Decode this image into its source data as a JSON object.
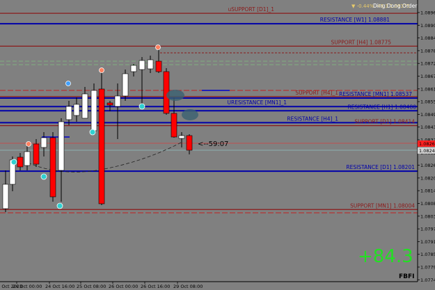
{
  "indicator_title": "Ding Dong Order",
  "top_info": "▼ -0.44%  -46.3  1.08375",
  "countdown": "<--59:07",
  "big_number": "+84.3",
  "watermark": "FBFI",
  "colors": {
    "background": "#808080",
    "support": "#8b1a1a",
    "resistance": "#0000aa",
    "bull_candle": "#ffffff",
    "bear_candle": "#ff0000",
    "big_number": "#22e022"
  },
  "levels": [
    {
      "label": "uSUPPORT [D1]_1",
      "price": 1.0893,
      "kind": "support"
    },
    {
      "label": "RESISTANCE [W1]  1.08881",
      "price": 1.08881,
      "kind": "resistance"
    },
    {
      "label": "SUPPORT [H4]  1.08775",
      "price": 1.08775,
      "kind": "support"
    },
    {
      "label": "SUPPORT [H4]_1",
      "price": 1.08537,
      "kind": "support"
    },
    {
      "label": "RESISTANCE [MN1]  1.08537",
      "price": 1.0853,
      "kind": "resistance"
    },
    {
      "label": "URESISTANCE [MN1]_1",
      "price": 1.0849,
      "kind": "resistance"
    },
    {
      "label": "RESISTANCE [H1]  1.08480",
      "price": 1.0847,
      "kind": "resistance"
    },
    {
      "label": "RESISTANCE [H4]_1",
      "price": 1.08414,
      "kind": "resistance"
    },
    {
      "label": "SUPPORT [D1]  1.08414",
      "price": 1.084,
      "kind": "support"
    },
    {
      "label": "RESISTANCE [D1]  1.08201",
      "price": 1.08185,
      "kind": "resistance"
    },
    {
      "label": "SUPPORT [MN1]  1.08004",
      "price": 1.08004,
      "kind": "support"
    }
  ],
  "price_axis": {
    "ticks": [
      "1.08960",
      "1.08900",
      "1.08845",
      "1.08785",
      "1.08725",
      "1.08670",
      "1.08610",
      "1.08550",
      "1.08495",
      "1.08435",
      "1.08375",
      "1.08320",
      "1.08260",
      "1.08200",
      "1.08145",
      "1.08085",
      "1.08030",
      "1.07970",
      "1.07910",
      "1.07855",
      "1.07795",
      "1.07740"
    ],
    "current_price": "1.08260",
    "bid_label": "1.08242",
    "top": 1.0896,
    "bottom": 1.0768
  },
  "time_axis": {
    "ticks": [
      "23 Oct 2023",
      "24 Oct 00:00",
      "24 Oct 16:00",
      "25 Oct 08:00",
      "26 Oct 00:00",
      "26 Oct 16:00",
      "29 Oct 08:00"
    ]
  }
}
